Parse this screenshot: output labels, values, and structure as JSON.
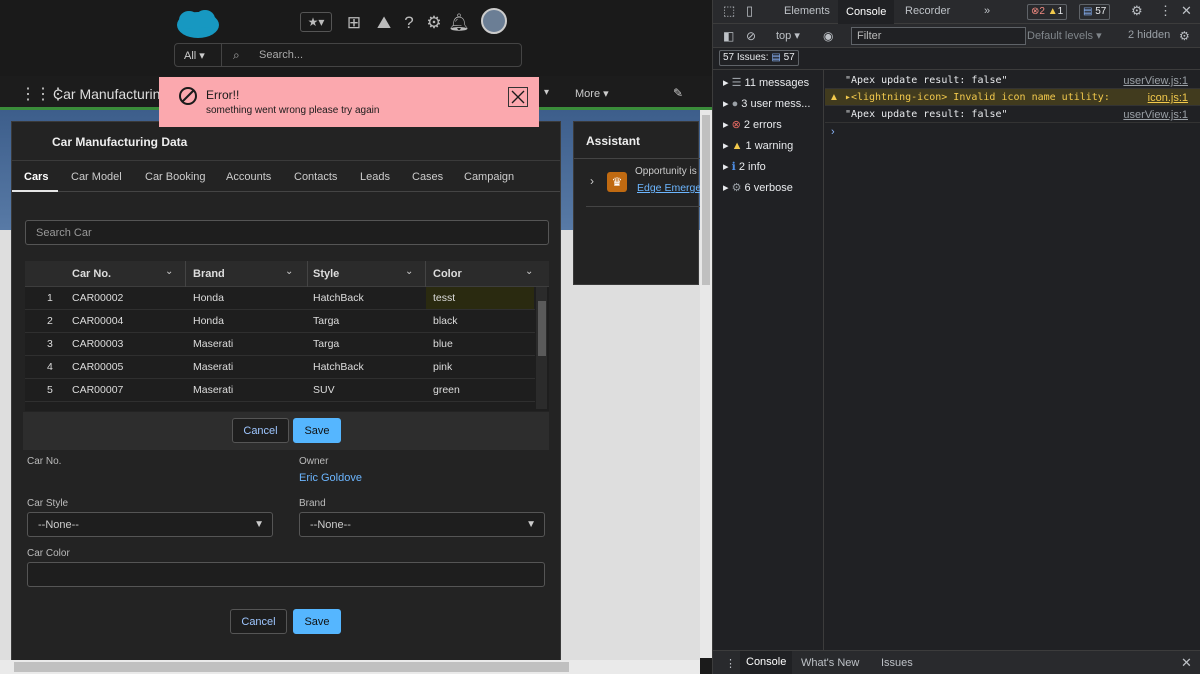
{
  "header": {
    "search_scope": "All",
    "search_placeholder": "Search...",
    "app_title": "Car Manufacturing",
    "more_label": "More"
  },
  "toast": {
    "title": "Error!!",
    "message": "something went wrong please try again"
  },
  "card": {
    "title": "Car Manufacturing Data",
    "tabs": [
      "Cars",
      "Car Model",
      "Car Booking",
      "Accounts",
      "Contacts",
      "Leads",
      "Cases",
      "Campaign"
    ],
    "active_tab": "Cars",
    "search_placeholder": "Search Car",
    "columns": [
      "Car No.",
      "Brand",
      "Style",
      "Color"
    ],
    "rows": [
      {
        "n": "1",
        "car": "CAR00002",
        "brand": "Honda",
        "style": "HatchBack",
        "color": "tesst"
      },
      {
        "n": "2",
        "car": "CAR00004",
        "brand": "Honda",
        "style": "Targa",
        "color": "black"
      },
      {
        "n": "3",
        "car": "CAR00003",
        "brand": "Maserati",
        "style": "Targa",
        "color": "blue"
      },
      {
        "n": "4",
        "car": "CAR00005",
        "brand": "Maserati",
        "style": "HatchBack",
        "color": "pink"
      },
      {
        "n": "5",
        "car": "CAR00007",
        "brand": "Maserati",
        "style": "SUV",
        "color": "green"
      }
    ],
    "cancel_label": "Cancel",
    "save_label": "Save",
    "form": {
      "car_no_label": "Car No.",
      "owner_label": "Owner",
      "owner_value": "Eric Goldove",
      "car_style_label": "Car Style",
      "car_style_value": "--None--",
      "brand_label": "Brand",
      "brand_value": "--None--",
      "car_color_label": "Car Color"
    }
  },
  "assistant": {
    "title": "Assistant",
    "item_text": "Opportunity is",
    "item_link": "Edge Emerge"
  },
  "devtools": {
    "tabs": [
      "Elements",
      "Console",
      "Recorder"
    ],
    "active_tab": "Console",
    "error_count": "2",
    "warning_count": "1",
    "message_count": "57",
    "context": "top",
    "filter_placeholder": "Filter",
    "levels": "Default levels",
    "hidden": "2 hidden",
    "issues_label": "57 Issues:",
    "issues_count": "57",
    "sidebar": [
      "11 messages",
      "3 user mess...",
      "2 errors",
      "1 warning",
      "2 info",
      "6 verbose"
    ],
    "messages": [
      {
        "text": "\"Apex update result: false\"",
        "src": "userView.js:1",
        "level": "log"
      },
      {
        "text": "<lightning-icon> Invalid icon name utility:",
        "src": "icon.js:1",
        "level": "warn"
      },
      {
        "text": "\"Apex update result: false\"",
        "src": "userView.js:1",
        "level": "log"
      }
    ],
    "drawer_tabs": [
      "Console",
      "What's New",
      "Issues"
    ]
  },
  "colors": {
    "toast_bg": "#fba8ae",
    "save_button": "#55b6ff",
    "devtools_bg": "#202124"
  }
}
